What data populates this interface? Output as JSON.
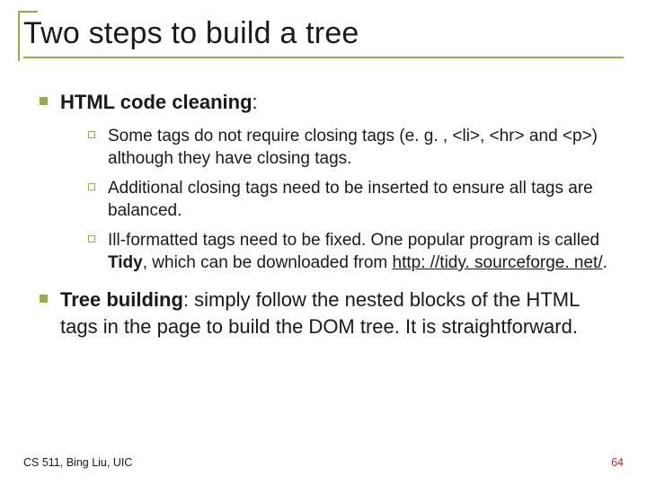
{
  "title": "Two steps to build a tree",
  "items": [
    {
      "label_bold": "HTML code cleaning",
      "label_suffix": ":",
      "sub": [
        "Some tags do not require closing tags (e. g. , <li>, <hr> and <p>) although they have closing tags.",
        "Additional closing tags need to be inserted to ensure all tags are balanced.",
        {
          "pre": "Ill-formatted tags need to be fixed. One popular program is called ",
          "bold": "Tidy",
          "mid": ", which can be downloaded from ",
          "link": "http: //tidy. sourceforge. net/",
          "post": "."
        }
      ]
    },
    {
      "label_bold": "Tree building",
      "label_suffix": ": simply follow the nested blocks of the HTML tags in the page to build the DOM tree. It is straightforward."
    }
  ],
  "footer": "CS 511, Bing Liu, UIC",
  "page_number": "64"
}
